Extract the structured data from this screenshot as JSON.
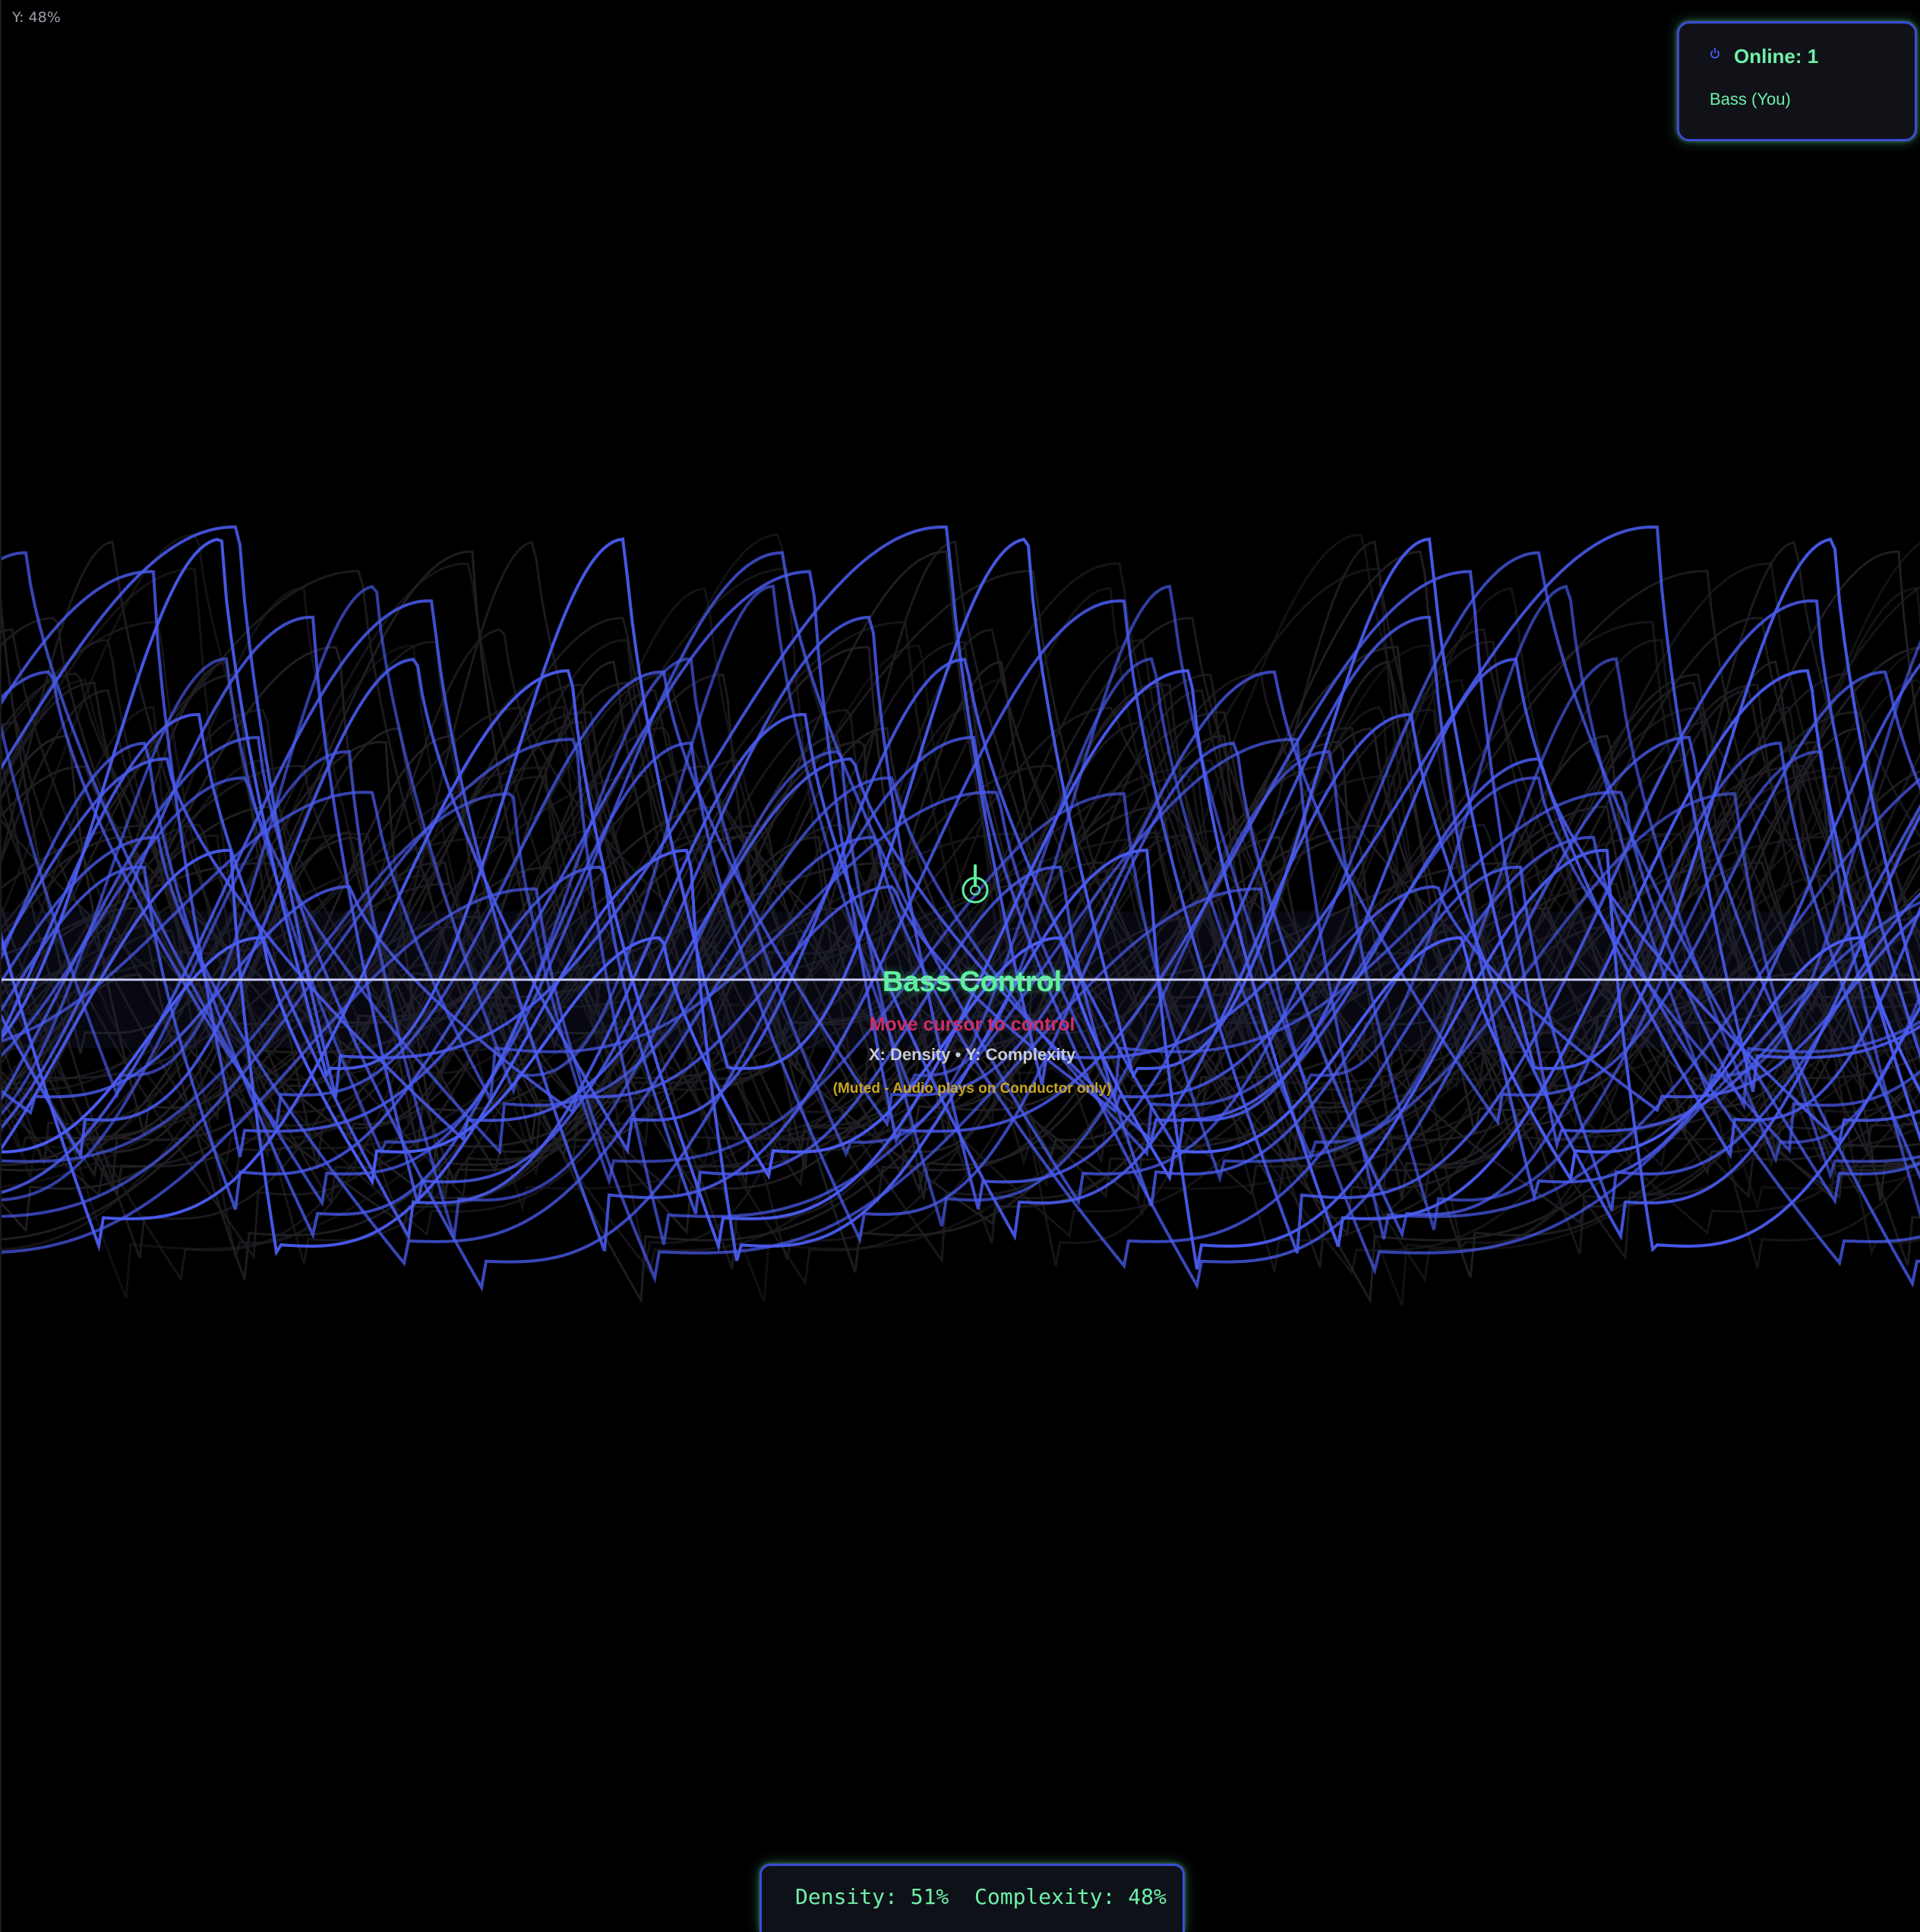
{
  "status_readout": "Y: 48%",
  "online_panel": {
    "icon": "power-icon",
    "count_label": "Online: 1",
    "user_label": "Bass (You)"
  },
  "cursor": {
    "icon": "touch-cursor-icon"
  },
  "overlay": {
    "title": "Bass Control",
    "instruction": "Move cursor to control",
    "axes_hint": "X: Density • Y: Complexity",
    "muted_note": "(Muted - Audio plays on Conductor only)"
  },
  "readout": {
    "density_label": "Density: 51%",
    "complexity_label": "Complexity: 48%"
  },
  "parameters": {
    "density": 0.51,
    "complexity": 0.48
  },
  "colors": {
    "background": "#000000",
    "wave_active": "#4a5cf0",
    "wave_faint": "#1f1f24",
    "accent_green": "#5ef0a0",
    "accent_pink": "#cc2f66",
    "accent_gold": "#c9a421",
    "panel_border": "#3d4bd6"
  }
}
